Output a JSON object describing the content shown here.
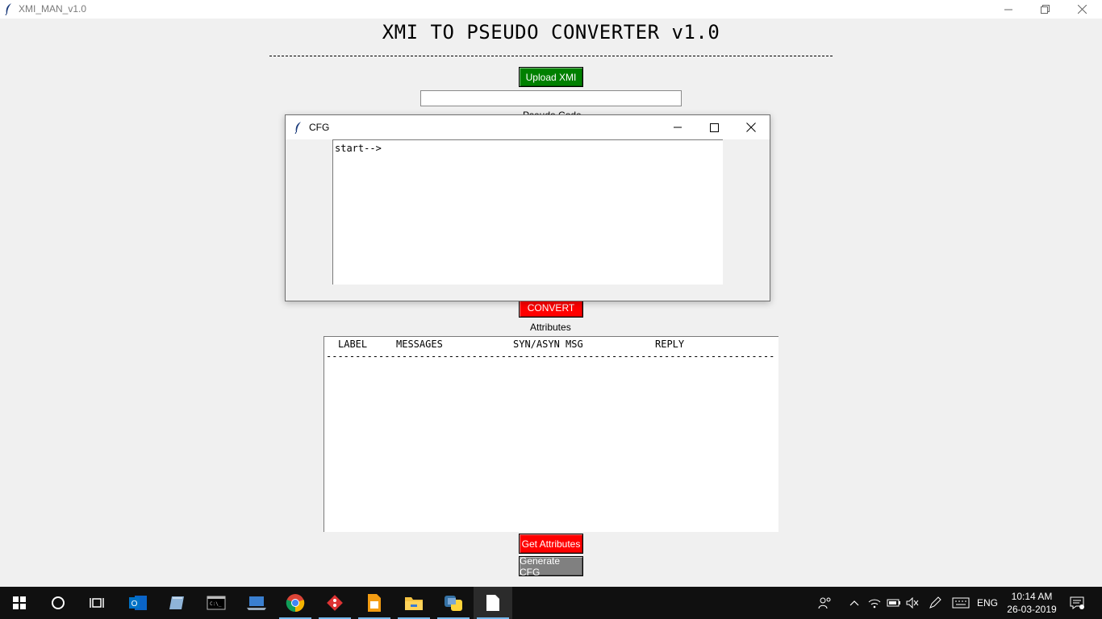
{
  "window": {
    "title": "XMI_MAN_v1.0"
  },
  "main": {
    "heading": "XMI TO PSEUDO CONVERTER v1.0",
    "upload_label": "Upload XMI",
    "file_path_value": "",
    "pseudo_label": "Pseudo Code",
    "convert_label": "CONVERT",
    "attributes_label": "Attributes",
    "attr_columns": {
      "label": "LABEL",
      "messages": "MESSAGES",
      "syn_asyn": "SYN/ASYN MSG",
      "reply": "REPLY"
    },
    "get_attributes_label": "Get Attributes",
    "generate_cfg_label": "Generate CFG"
  },
  "dialog": {
    "title": "CFG",
    "text": "start-->"
  },
  "taskbar": {
    "language": "ENG",
    "time": "10:14 AM",
    "date": "26-03-2019"
  },
  "colors": {
    "upload": "#008000",
    "convert": "#ff0000",
    "get_attributes": "#ff0000",
    "generate_cfg": "#808080"
  }
}
